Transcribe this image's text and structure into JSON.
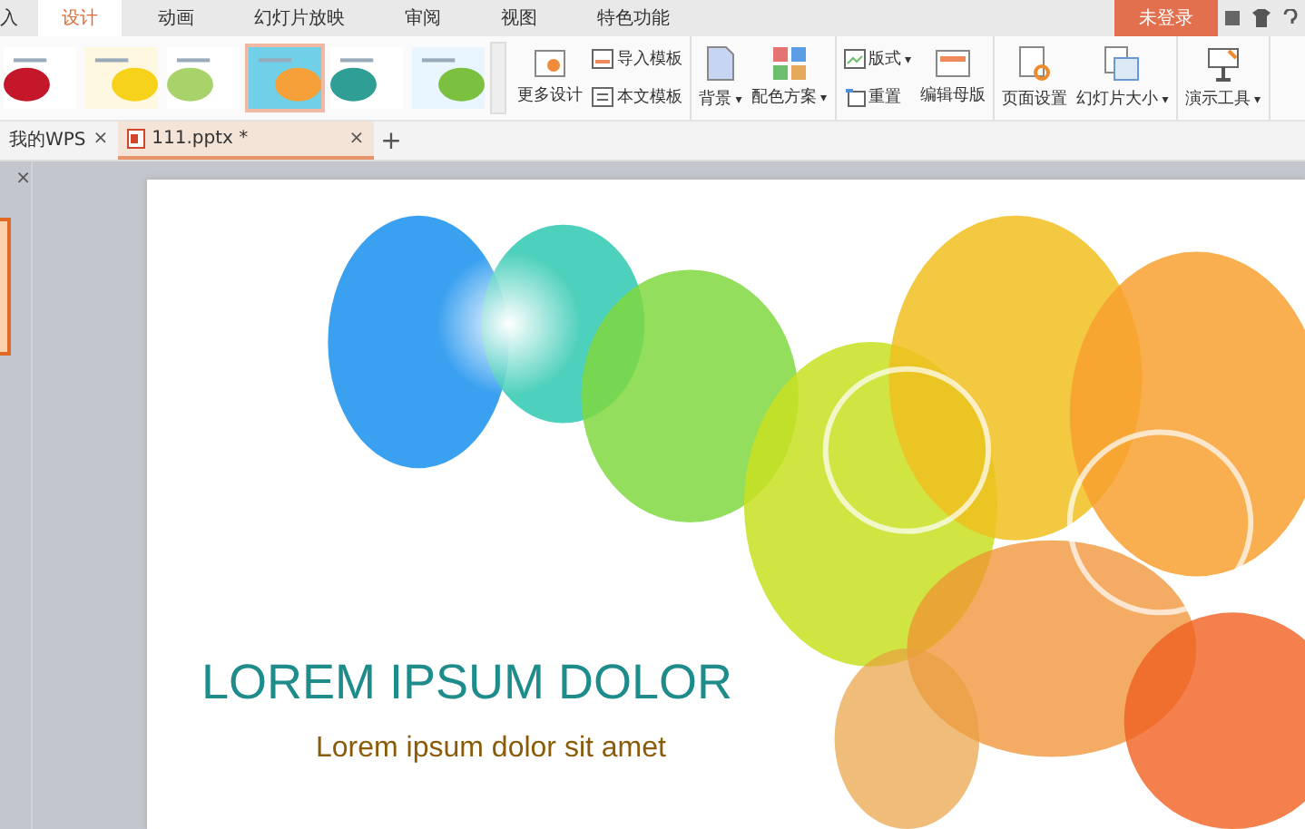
{
  "ribbon_tabs": [
    {
      "label": "入",
      "selected": false
    },
    {
      "label": "设计",
      "selected": true
    },
    {
      "label": "动画",
      "selected": false
    },
    {
      "label": "幻灯片放映",
      "selected": false
    },
    {
      "label": "审阅",
      "selected": false
    },
    {
      "label": "视图",
      "selected": false
    },
    {
      "label": "特色功能",
      "selected": false
    }
  ],
  "login_button": "未登录",
  "templates": [
    {
      "selected": false
    },
    {
      "selected": false
    },
    {
      "selected": false
    },
    {
      "selected": true
    },
    {
      "selected": false
    },
    {
      "selected": false
    }
  ],
  "groups": [
    {
      "items": [
        {
          "kind": "large",
          "label": "更多设计"
        },
        {
          "kind": "stack",
          "items": [
            {
              "label": "导入模板"
            },
            {
              "label": "本文模板"
            }
          ]
        }
      ]
    },
    {
      "items": [
        {
          "kind": "large",
          "label": "背景",
          "caret": "▾"
        },
        {
          "kind": "large",
          "label": "配色方案",
          "caret": "▾"
        }
      ]
    },
    {
      "items": [
        {
          "kind": "stack",
          "items": [
            {
              "label": "版式",
              "caret": "▾"
            },
            {
              "label": "重置"
            }
          ]
        },
        {
          "kind": "large",
          "label": "编辑母版"
        }
      ]
    },
    {
      "items": [
        {
          "kind": "large",
          "label": "页面设置"
        },
        {
          "kind": "large",
          "label": "幻灯片大小",
          "caret": "▾"
        }
      ]
    },
    {
      "items": [
        {
          "kind": "large",
          "label": "演示工具",
          "caret": "▾"
        }
      ]
    }
  ],
  "doc_tabs": [
    {
      "label": "我的WPS",
      "selected": false,
      "kind": "home",
      "close": "×"
    },
    {
      "label": "111.pptx *",
      "selected": true,
      "kind": "file",
      "close": "×"
    }
  ],
  "new_tab": "+",
  "panel_close": "×",
  "slide": {
    "title": "LOREM IPSUM DOLOR",
    "subtitle": "Lorem ipsum dolor sit amet"
  }
}
